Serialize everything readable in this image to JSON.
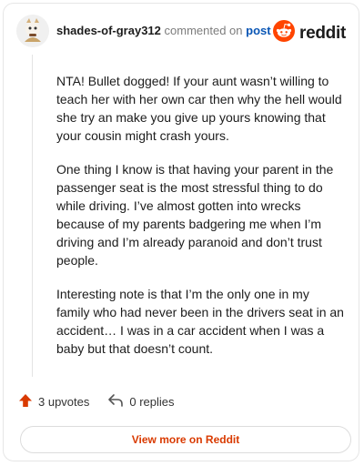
{
  "header": {
    "username": "shades-of-gray312",
    "commented_on": "commented on",
    "post_link": "post",
    "logo_text": "reddit"
  },
  "comment": {
    "paragraphs": [
      "NTA! Bullet dogged! If your aunt wasn’t willing to teach her with her own car then why the hell would she try an make you give up yours knowing that your cousin might crash yours.",
      "One thing I know is that having your parent in the passenger seat is the most stressful thing to do while driving. I’ve almost gotten into wrecks because of my parents badgering me when I’m driving and I’m already paranoid and don’t trust people.",
      "Interesting note is that I’m the only one in my family who had never been in the drivers seat in an accident… I was in a car accident when I was a baby but that doesn’t count."
    ]
  },
  "actions": {
    "upvotes": "3 upvotes",
    "replies": "0 replies"
  },
  "footer": {
    "view_more": "View more on Reddit"
  },
  "colors": {
    "brand": "#ff4500",
    "upvote": "#d93a00",
    "link": "#0a56b5"
  }
}
